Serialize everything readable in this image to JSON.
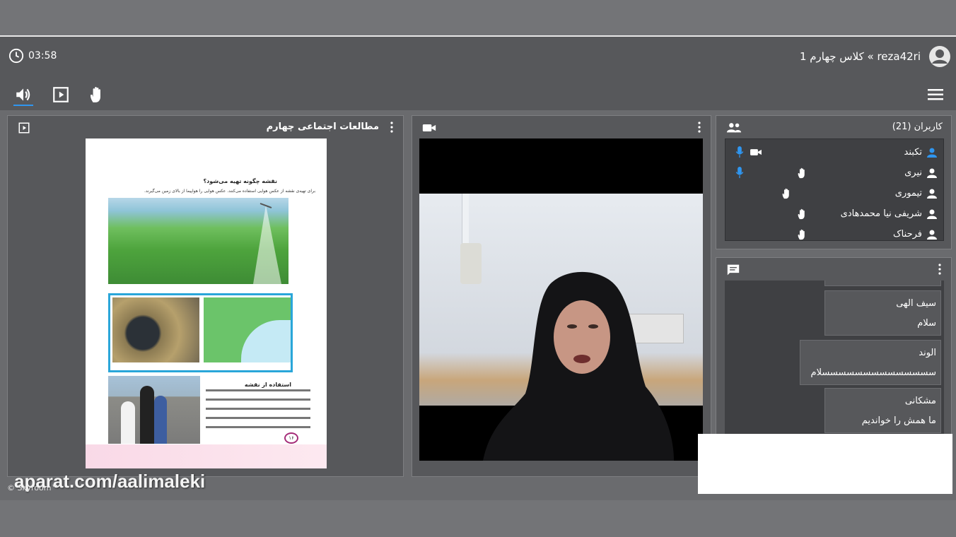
{
  "header": {
    "timer": "03:58",
    "breadcrumb": "reza42ri » کلاس چهارم 1"
  },
  "document_panel": {
    "title": "مطالعات اجتماعی چهارم",
    "page": {
      "heading": "نقشه چگونه تهیه می‌شود؟",
      "line": "برای تهیه‌ی نقشه از عکس هوایی استفاده می‌کنند. عکس هوایی را هواپیما از بالای زمین می‌گیرند.",
      "subheading": "استفاده از نقشه",
      "page_number": "۱۶"
    }
  },
  "users_panel": {
    "title": "کاربران (21)",
    "users": [
      {
        "name": "تکبند",
        "mic": true,
        "camera": true,
        "hand": false,
        "active": true
      },
      {
        "name": "نیری",
        "mic": true,
        "camera": false,
        "hand": true,
        "active": false
      },
      {
        "name": "تیموری",
        "mic": false,
        "camera": false,
        "hand": true,
        "active": false
      },
      {
        "name": "شریفی نیا محمدهادی",
        "mic": false,
        "camera": false,
        "hand": true,
        "active": false
      },
      {
        "name": "فرحناک",
        "mic": false,
        "camera": false,
        "hand": true,
        "active": false
      }
    ]
  },
  "chat_panel": {
    "messages": [
      {
        "name": "سیف الهی",
        "text": "سلام"
      },
      {
        "name": "الوند",
        "text": "سسسسسسسسسسسسسسلام"
      },
      {
        "name": "مشکانی",
        "text": "ما همش را خواندیم"
      }
    ]
  },
  "footer": {
    "watermark": "aparat.com/aalimaleki",
    "copyright": "© Skyroom™"
  },
  "colors": {
    "accent": "#2f96f0",
    "panel": "#57585b",
    "list_bg": "#3f4043"
  },
  "icons": [
    "clock-icon",
    "avatar-icon",
    "speaker-icon",
    "presentation-icon",
    "raise-hand-icon",
    "menu-icon",
    "camera-icon",
    "users-icon",
    "chat-icon",
    "mic-icon",
    "user-icon"
  ]
}
